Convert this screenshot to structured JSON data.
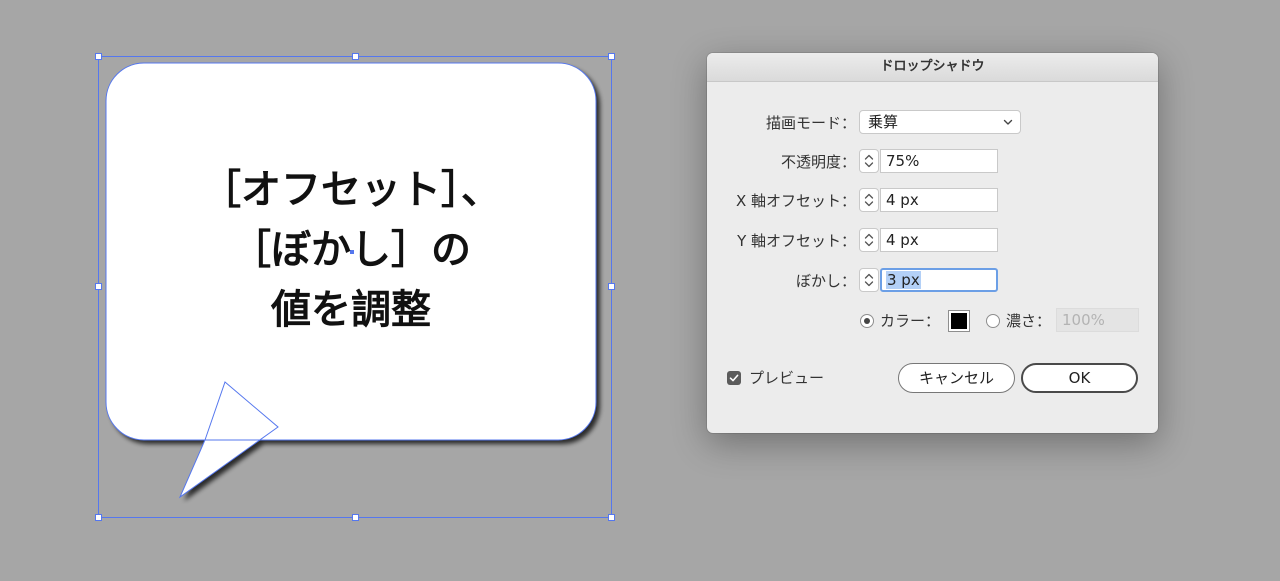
{
  "artboard": {
    "bubble_text": [
      "［オフセット］、",
      "［ぼかし］の",
      "値を調整"
    ]
  },
  "dialog": {
    "title": "ドロップシャドウ",
    "mode": {
      "label": "描画モード：",
      "value": "乗算"
    },
    "opacity": {
      "label": "不透明度：",
      "value": "75%"
    },
    "x_offset": {
      "label": "X 軸オフセット：",
      "value": "4 px"
    },
    "y_offset": {
      "label": "Y 軸オフセット：",
      "value": "4 px"
    },
    "blur": {
      "label": "ぼかし：",
      "value": "3 px"
    },
    "color_option": {
      "label": "カラー：",
      "checked": true,
      "swatch_color": "#000000"
    },
    "darkness_option": {
      "label": "濃さ：",
      "value": "100%",
      "checked": false
    },
    "preview": {
      "label": "プレビュー",
      "checked": true
    },
    "buttons": {
      "cancel": "キャンセル",
      "ok": "OK"
    }
  },
  "colors": {
    "canvas": "#a6a6a6",
    "selection": "#5577ee",
    "focus_ring": "#6c9fe6"
  }
}
